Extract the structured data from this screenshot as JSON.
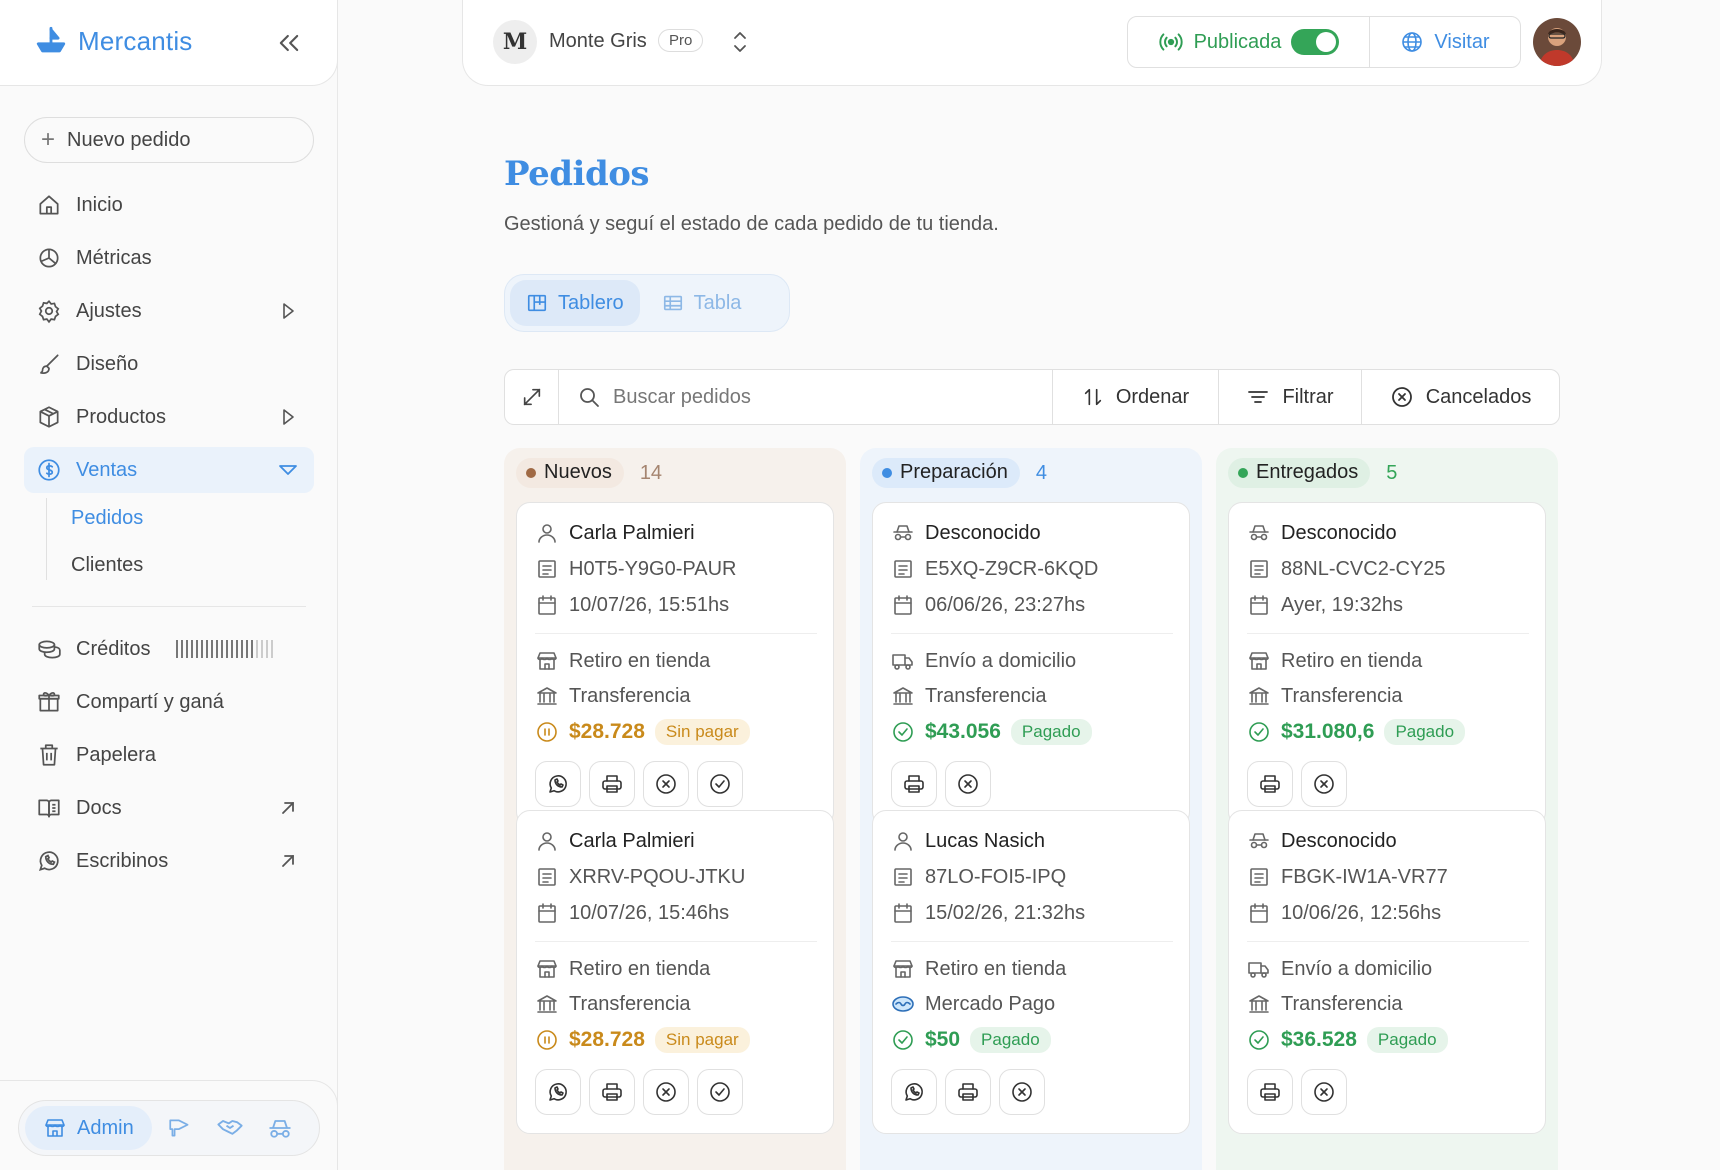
{
  "app": {
    "brand": "Mercantis",
    "new_order_label": "Nuevo pedido",
    "nav": {
      "inicio": "Inicio",
      "metricas": "Métricas",
      "ajustes": "Ajustes",
      "diseno": "Diseño",
      "productos": "Productos",
      "ventas": "Ventas",
      "pedidos": "Pedidos",
      "clientes": "Clientes",
      "creditos": "Créditos",
      "comparti": "Compartí y ganá",
      "papelera": "Papelera",
      "docs": "Docs",
      "escribinos": "Escribinos"
    },
    "credits_level": 0.8,
    "mode_admin": "Admin"
  },
  "topbar": {
    "store_initial": "M",
    "store_name": "Monte Gris",
    "plan": "Pro",
    "published_label": "Publicada",
    "published": true,
    "visit_label": "Visitar"
  },
  "page": {
    "title": "Pedidos",
    "subtitle": "Gestioná y seguí el estado de cada pedido de tu tienda.",
    "tab_board": "Tablero",
    "tab_table": "Tabla",
    "search_placeholder": "Buscar pedidos",
    "sort_label": "Ordenar",
    "filter_label": "Filtrar",
    "cancelled_label": "Cancelados"
  },
  "columns": [
    {
      "title": "Nuevos",
      "count": "14",
      "pill_bg": "#f3e9e1",
      "dot": "#a06a45",
      "count_color": "#a58570",
      "col_bg": "#f6f1ec",
      "cards": [
        {
          "customer": "Carla Palmieri",
          "customer_icon": "user-icon",
          "code": "H0T5-Y9G0-PAUR",
          "date": "10/07/26, 15:51hs",
          "delivery": "Retiro en tienda",
          "delivery_icon": "store-icon",
          "payment": "Transferencia",
          "payment_icon": "bank-icon",
          "amount": "$28.728",
          "status": "Sin pagar",
          "status_type": "unpaid",
          "actions": [
            "whatsapp-icon",
            "printer-icon",
            "cancel-icon",
            "check-icon"
          ]
        },
        {
          "customer": "Carla Palmieri",
          "customer_icon": "user-icon",
          "code": "XRRV-PQOU-JTKU",
          "date": "10/07/26, 15:46hs",
          "delivery": "Retiro en tienda",
          "delivery_icon": "store-icon",
          "payment": "Transferencia",
          "payment_icon": "bank-icon",
          "amount": "$28.728",
          "status": "Sin pagar",
          "status_type": "unpaid",
          "actions": [
            "whatsapp-icon",
            "printer-icon",
            "cancel-icon",
            "check-icon"
          ]
        }
      ]
    },
    {
      "title": "Preparación",
      "count": "4",
      "pill_bg": "#dceafa",
      "dot": "#3f8de2",
      "count_color": "#3f8de2",
      "col_bg": "#eef4fb",
      "cards": [
        {
          "customer": "Desconocido",
          "customer_icon": "incognito-icon",
          "code": "E5XQ-Z9CR-6KQD",
          "date": "06/06/26, 23:27hs",
          "delivery": "Envío a domicilio",
          "delivery_icon": "truck-icon",
          "payment": "Transferencia",
          "payment_icon": "bank-icon",
          "amount": "$43.056",
          "status": "Pagado",
          "status_type": "paid",
          "actions": [
            "printer-icon",
            "cancel-icon"
          ]
        },
        {
          "customer": "Lucas Nasich",
          "customer_icon": "user-icon",
          "code": "87LO-FOI5-IPQ",
          "date": "15/02/26, 21:32hs",
          "delivery": "Retiro en tienda",
          "delivery_icon": "store-icon",
          "payment": "Mercado Pago",
          "payment_icon": "mercadopago-icon",
          "amount": "$50",
          "status": "Pagado",
          "status_type": "paid",
          "actions": [
            "whatsapp-icon",
            "printer-icon",
            "cancel-icon"
          ]
        }
      ]
    },
    {
      "title": "Entregados",
      "count": "5",
      "pill_bg": "#dff0e4",
      "dot": "#34a558",
      "count_color": "#34a558",
      "col_bg": "#eef6f0",
      "cards": [
        {
          "customer": "Desconocido",
          "customer_icon": "incognito-icon",
          "code": "88NL-CVC2-CY25",
          "date": "Ayer, 19:32hs",
          "delivery": "Retiro en tienda",
          "delivery_icon": "store-icon",
          "payment": "Transferencia",
          "payment_icon": "bank-icon",
          "amount": "$31.080,6",
          "status": "Pagado",
          "status_type": "paid",
          "actions": [
            "printer-icon",
            "cancel-icon"
          ]
        },
        {
          "customer": "Desconocido",
          "customer_icon": "incognito-icon",
          "code": "FBGK-IW1A-VR77",
          "date": "10/06/26, 12:56hs",
          "delivery": "Envío a domicilio",
          "delivery_icon": "truck-icon",
          "payment": "Transferencia",
          "payment_icon": "bank-icon",
          "amount": "$36.528",
          "status": "Pagado",
          "status_type": "paid",
          "actions": [
            "printer-icon",
            "cancel-icon"
          ]
        }
      ]
    }
  ],
  "colors": {
    "accent": "#3f8de2",
    "success": "#2f9d54",
    "success_bg": "#e6f4ea",
    "warning": "#c98a1b",
    "warning_bg": "#fbf1dc"
  }
}
